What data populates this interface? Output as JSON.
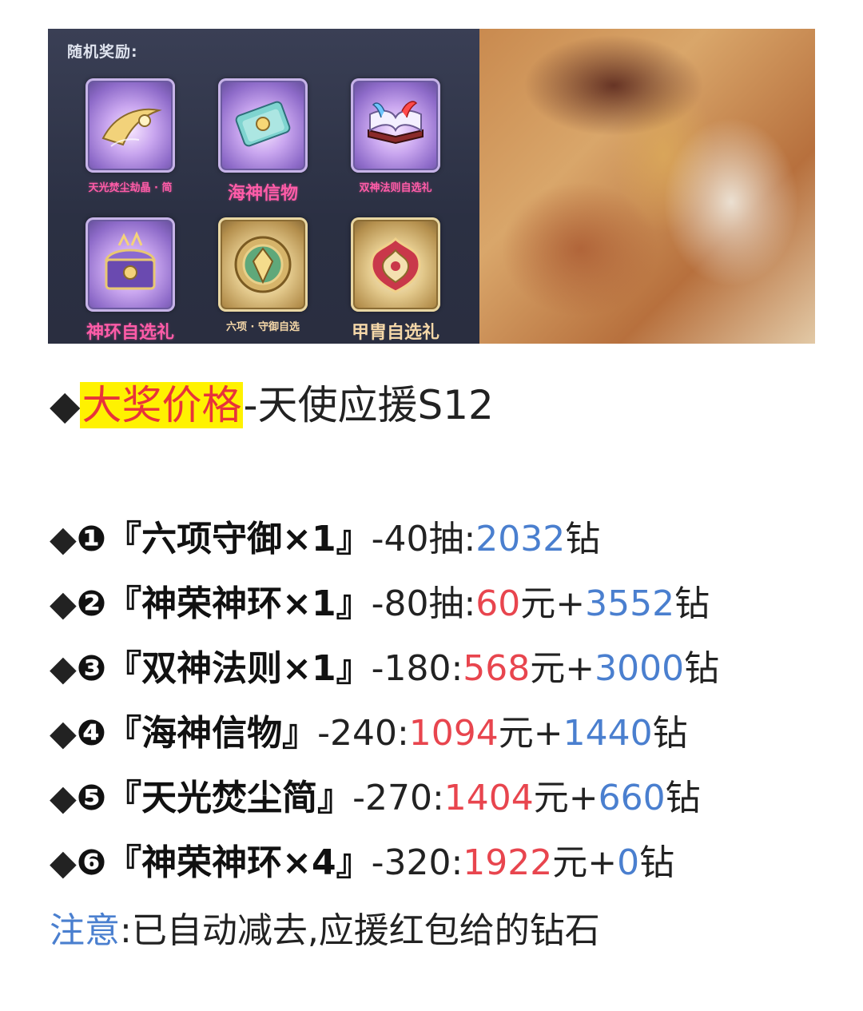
{
  "banner": {
    "rewards_heading": "随机奖励:",
    "rewards": [
      {
        "name": "天光焚尘劫晶 · 简",
        "icon": "golden-blade-icon"
      },
      {
        "name": "海神信物",
        "icon": "token-card-icon"
      },
      {
        "name": "双神法则自选礼",
        "icon": "spellbook-icon"
      },
      {
        "name": "神环自选礼",
        "icon": "treasure-chest-icon"
      },
      {
        "name": "六项 · 守御自选",
        "icon": "shield-emblem-icon"
      },
      {
        "name": "甲胄自选礼",
        "icon": "armor-crest-icon"
      }
    ]
  },
  "title": {
    "bullet": "◆",
    "highlight": "大奖价格",
    "rest": "-天使应援S12"
  },
  "items": [
    {
      "num": "❶",
      "open": "『",
      "n1": "六",
      "n2": "项",
      "n3": "守御×1",
      "close": "』",
      "draws": "-40抽:",
      "yuan": "",
      "yuan_unit": "",
      "diamonds": "2032",
      "diamond_unit": "钻"
    },
    {
      "num": "❷",
      "open": "『",
      "n1": "神",
      "n2": "荣",
      "n3": "神环×1",
      "close": "』",
      "draws": "-80抽:",
      "yuan": "60",
      "yuan_unit": "元+",
      "diamonds": "3552",
      "diamond_unit": "钻"
    },
    {
      "num": "❸",
      "open": "『",
      "n1": "双神",
      "n2": "法",
      "n3": "则×1",
      "close": "』",
      "draws": "-180:",
      "yuan": "568",
      "yuan_unit": "元+",
      "diamonds": "3000",
      "diamond_unit": "钻"
    },
    {
      "num": "❹",
      "open": "『",
      "n1": "",
      "n2": "海",
      "n3": "神信物",
      "close": "』",
      "draws": "-240:",
      "yuan": "1094",
      "yuan_unit": "元+",
      "diamonds": "1440",
      "diamond_unit": "钻"
    },
    {
      "num": "❺",
      "open": "『",
      "n1": "天光焚尘",
      "n2": "简",
      "n3": "",
      "close": "』",
      "draws": "-270:",
      "yuan": "1404",
      "yuan_unit": "元+",
      "diamonds": "660",
      "diamond_unit": "钻"
    },
    {
      "num": "❻",
      "open": "『",
      "n1": "神",
      "n2": "荣",
      "n3": "神环×4",
      "close": "』",
      "draws": "-320:",
      "yuan": "1922",
      "yuan_unit": "元+",
      "diamonds": "0",
      "diamond_unit": "钻"
    }
  ],
  "note": {
    "label": "注意",
    "text": ":已自动减去,应援红包给的钻石"
  },
  "colors": {
    "highlight_bg": "#fff200",
    "red": "#e8454e",
    "blue": "#4a7fcf",
    "reward_name": "#ff5ca8"
  }
}
